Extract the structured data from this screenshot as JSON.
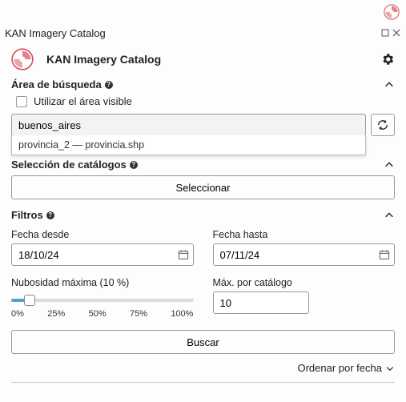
{
  "panel": {
    "title": "KAN Imagery Catalog",
    "heading": "KAN Imagery Catalog"
  },
  "area": {
    "title": "Área de búsqueda",
    "visible_label": "Utilizar el área visible",
    "search_value": "buenos_aires",
    "suggestion": "provincia_2 — provincia.shp"
  },
  "catalogs": {
    "title": "Selección de catálogos",
    "select_button": "Seleccionar"
  },
  "filters": {
    "title": "Filtros",
    "date_from_label": "Fecha desde",
    "date_from_value": "18/10/24",
    "date_to_label": "Fecha hasta",
    "date_to_value": "07/11/24",
    "cloud_label": "Nubosidad máxima (10 %)",
    "slider_ticks": [
      "0%",
      "25%",
      "50%",
      "75%",
      "100%"
    ],
    "max_per_catalog_label": "Máx. por catálogo",
    "max_per_catalog_value": "10",
    "search_button": "Buscar"
  },
  "results": {
    "order_by": "Ordenar por fecha"
  }
}
